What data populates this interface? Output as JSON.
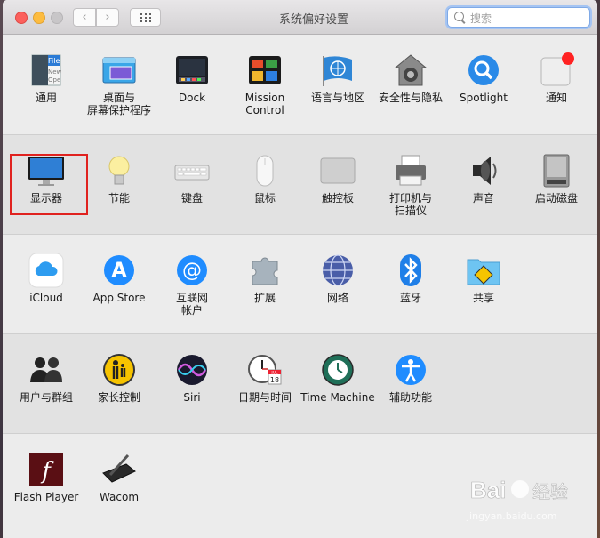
{
  "window": {
    "title": "系统偏好设置"
  },
  "toolbar": {
    "back": "‹",
    "forward": "›"
  },
  "search": {
    "placeholder": "搜索"
  },
  "rows": [
    [
      {
        "id": "general",
        "label": "通用",
        "icon": "general-icon"
      },
      {
        "id": "desktop",
        "label": "桌面与\n屏幕保护程序",
        "icon": "desktop-icon"
      },
      {
        "id": "dock",
        "label": "Dock",
        "icon": "dock-icon"
      },
      {
        "id": "mission",
        "label": "Mission\nControl",
        "icon": "mission-control-icon"
      },
      {
        "id": "language",
        "label": "语言与地区",
        "icon": "language-flag-icon"
      },
      {
        "id": "security",
        "label": "安全性与隐私",
        "icon": "security-house-icon"
      },
      {
        "id": "spotlight",
        "label": "Spotlight",
        "icon": "spotlight-icon"
      },
      {
        "id": "notifications",
        "label": "通知",
        "icon": "notifications-icon"
      }
    ],
    [
      {
        "id": "displays",
        "label": "显示器",
        "icon": "display-icon"
      },
      {
        "id": "energy",
        "label": "节能",
        "icon": "lightbulb-icon"
      },
      {
        "id": "keyboard",
        "label": "键盘",
        "icon": "keyboard-icon"
      },
      {
        "id": "mouse",
        "label": "鼠标",
        "icon": "mouse-icon"
      },
      {
        "id": "trackpad",
        "label": "触控板",
        "icon": "trackpad-icon"
      },
      {
        "id": "printers",
        "label": "打印机与\n扫描仪",
        "icon": "printer-icon"
      },
      {
        "id": "sound",
        "label": "声音",
        "icon": "speaker-icon"
      },
      {
        "id": "startup",
        "label": "启动磁盘",
        "icon": "disk-icon"
      }
    ],
    [
      {
        "id": "icloud",
        "label": "iCloud",
        "icon": "icloud-icon"
      },
      {
        "id": "appstore",
        "label": "App Store",
        "icon": "app-store-icon"
      },
      {
        "id": "internet",
        "label": "互联网\n帐户",
        "icon": "internet-accounts-icon"
      },
      {
        "id": "extensions",
        "label": "扩展",
        "icon": "puzzle-icon"
      },
      {
        "id": "network",
        "label": "网络",
        "icon": "network-globe-icon"
      },
      {
        "id": "bluetooth",
        "label": "蓝牙",
        "icon": "bluetooth-icon"
      },
      {
        "id": "sharing",
        "label": "共享",
        "icon": "sharing-folder-icon"
      }
    ],
    [
      {
        "id": "users",
        "label": "用户与群组",
        "icon": "users-icon"
      },
      {
        "id": "parental",
        "label": "家长控制",
        "icon": "parental-controls-icon"
      },
      {
        "id": "siri",
        "label": "Siri",
        "icon": "siri-icon"
      },
      {
        "id": "datetime",
        "label": "日期与时间",
        "icon": "clock-calendar-icon"
      },
      {
        "id": "timemachine",
        "label": "Time Machine",
        "icon": "time-machine-icon"
      },
      {
        "id": "accessibility",
        "label": "辅助功能",
        "icon": "accessibility-icon"
      }
    ],
    [
      {
        "id": "flash",
        "label": "Flash Player",
        "icon": "flash-icon"
      },
      {
        "id": "wacom",
        "label": "Wacom",
        "icon": "wacom-tablet-icon"
      }
    ]
  ],
  "icon_texts": {
    "general_file": "File",
    "general_new": "New",
    "general_ope": "Ope",
    "calendar_month": "JUL",
    "calendar_day": "18",
    "flash_letter": "f",
    "appstore_letter": "A",
    "internet_at": "@"
  },
  "watermark": {
    "brand": "Bai",
    "brand2": "经验",
    "url": "jingyan.baidu.com"
  },
  "colors": {
    "selection": "#e0221f",
    "accent": "#1f8cff"
  }
}
